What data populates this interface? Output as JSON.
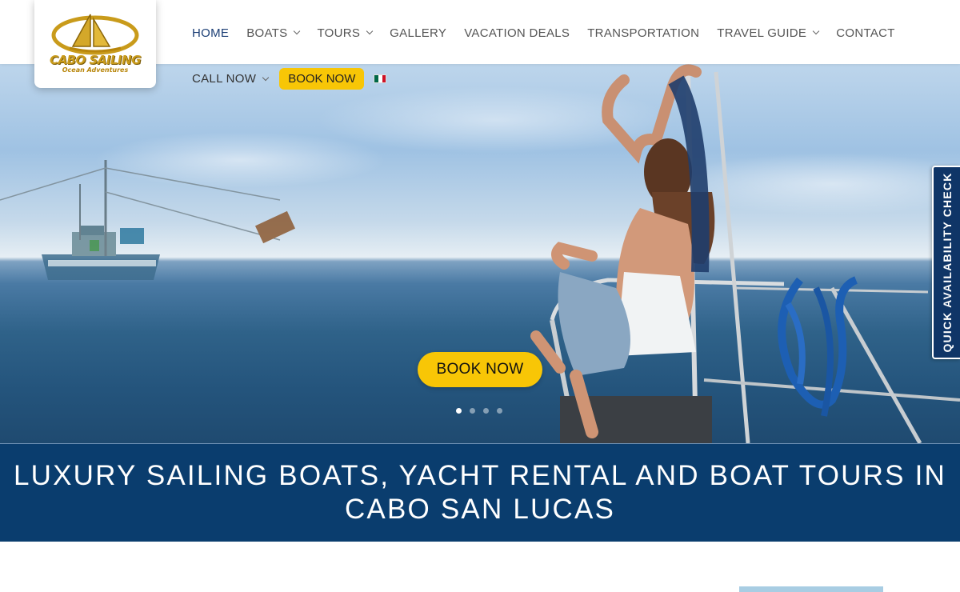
{
  "brand": {
    "logo_main": "CABO SAILING",
    "logo_sub": "Ocean Adventures"
  },
  "nav": {
    "items": [
      {
        "label": "HOME",
        "active": true,
        "has_dropdown": false
      },
      {
        "label": "BOATS",
        "active": false,
        "has_dropdown": true
      },
      {
        "label": "TOURS",
        "active": false,
        "has_dropdown": true
      },
      {
        "label": "GALLERY",
        "active": false,
        "has_dropdown": false
      },
      {
        "label": "VACATION DEALS",
        "active": false,
        "has_dropdown": false
      },
      {
        "label": "TRANSPORTATION",
        "active": false,
        "has_dropdown": false
      },
      {
        "label": "TRAVEL GUIDE",
        "active": false,
        "has_dropdown": true
      },
      {
        "label": "CONTACT",
        "active": false,
        "has_dropdown": false
      }
    ],
    "call_now": "CALL NOW",
    "book_now": "BOOK NOW",
    "language_flag": "mexico-flag-icon"
  },
  "hero": {
    "cta_label": "BOOK NOW",
    "slides_count": 4,
    "active_slide": 1
  },
  "quick_availability": "QUICK AVAILABILITY CHECK",
  "banner": {
    "title": "LUXURY SAILING BOATS, YACHT RENTAL AND BOAT TOURS IN CABO SAN LUCAS"
  },
  "colors": {
    "nav_active": "#1b3e75",
    "accent_yellow": "#f8c606",
    "banner_blue": "#0a3d6e",
    "quick_tab": "#0f3567"
  }
}
